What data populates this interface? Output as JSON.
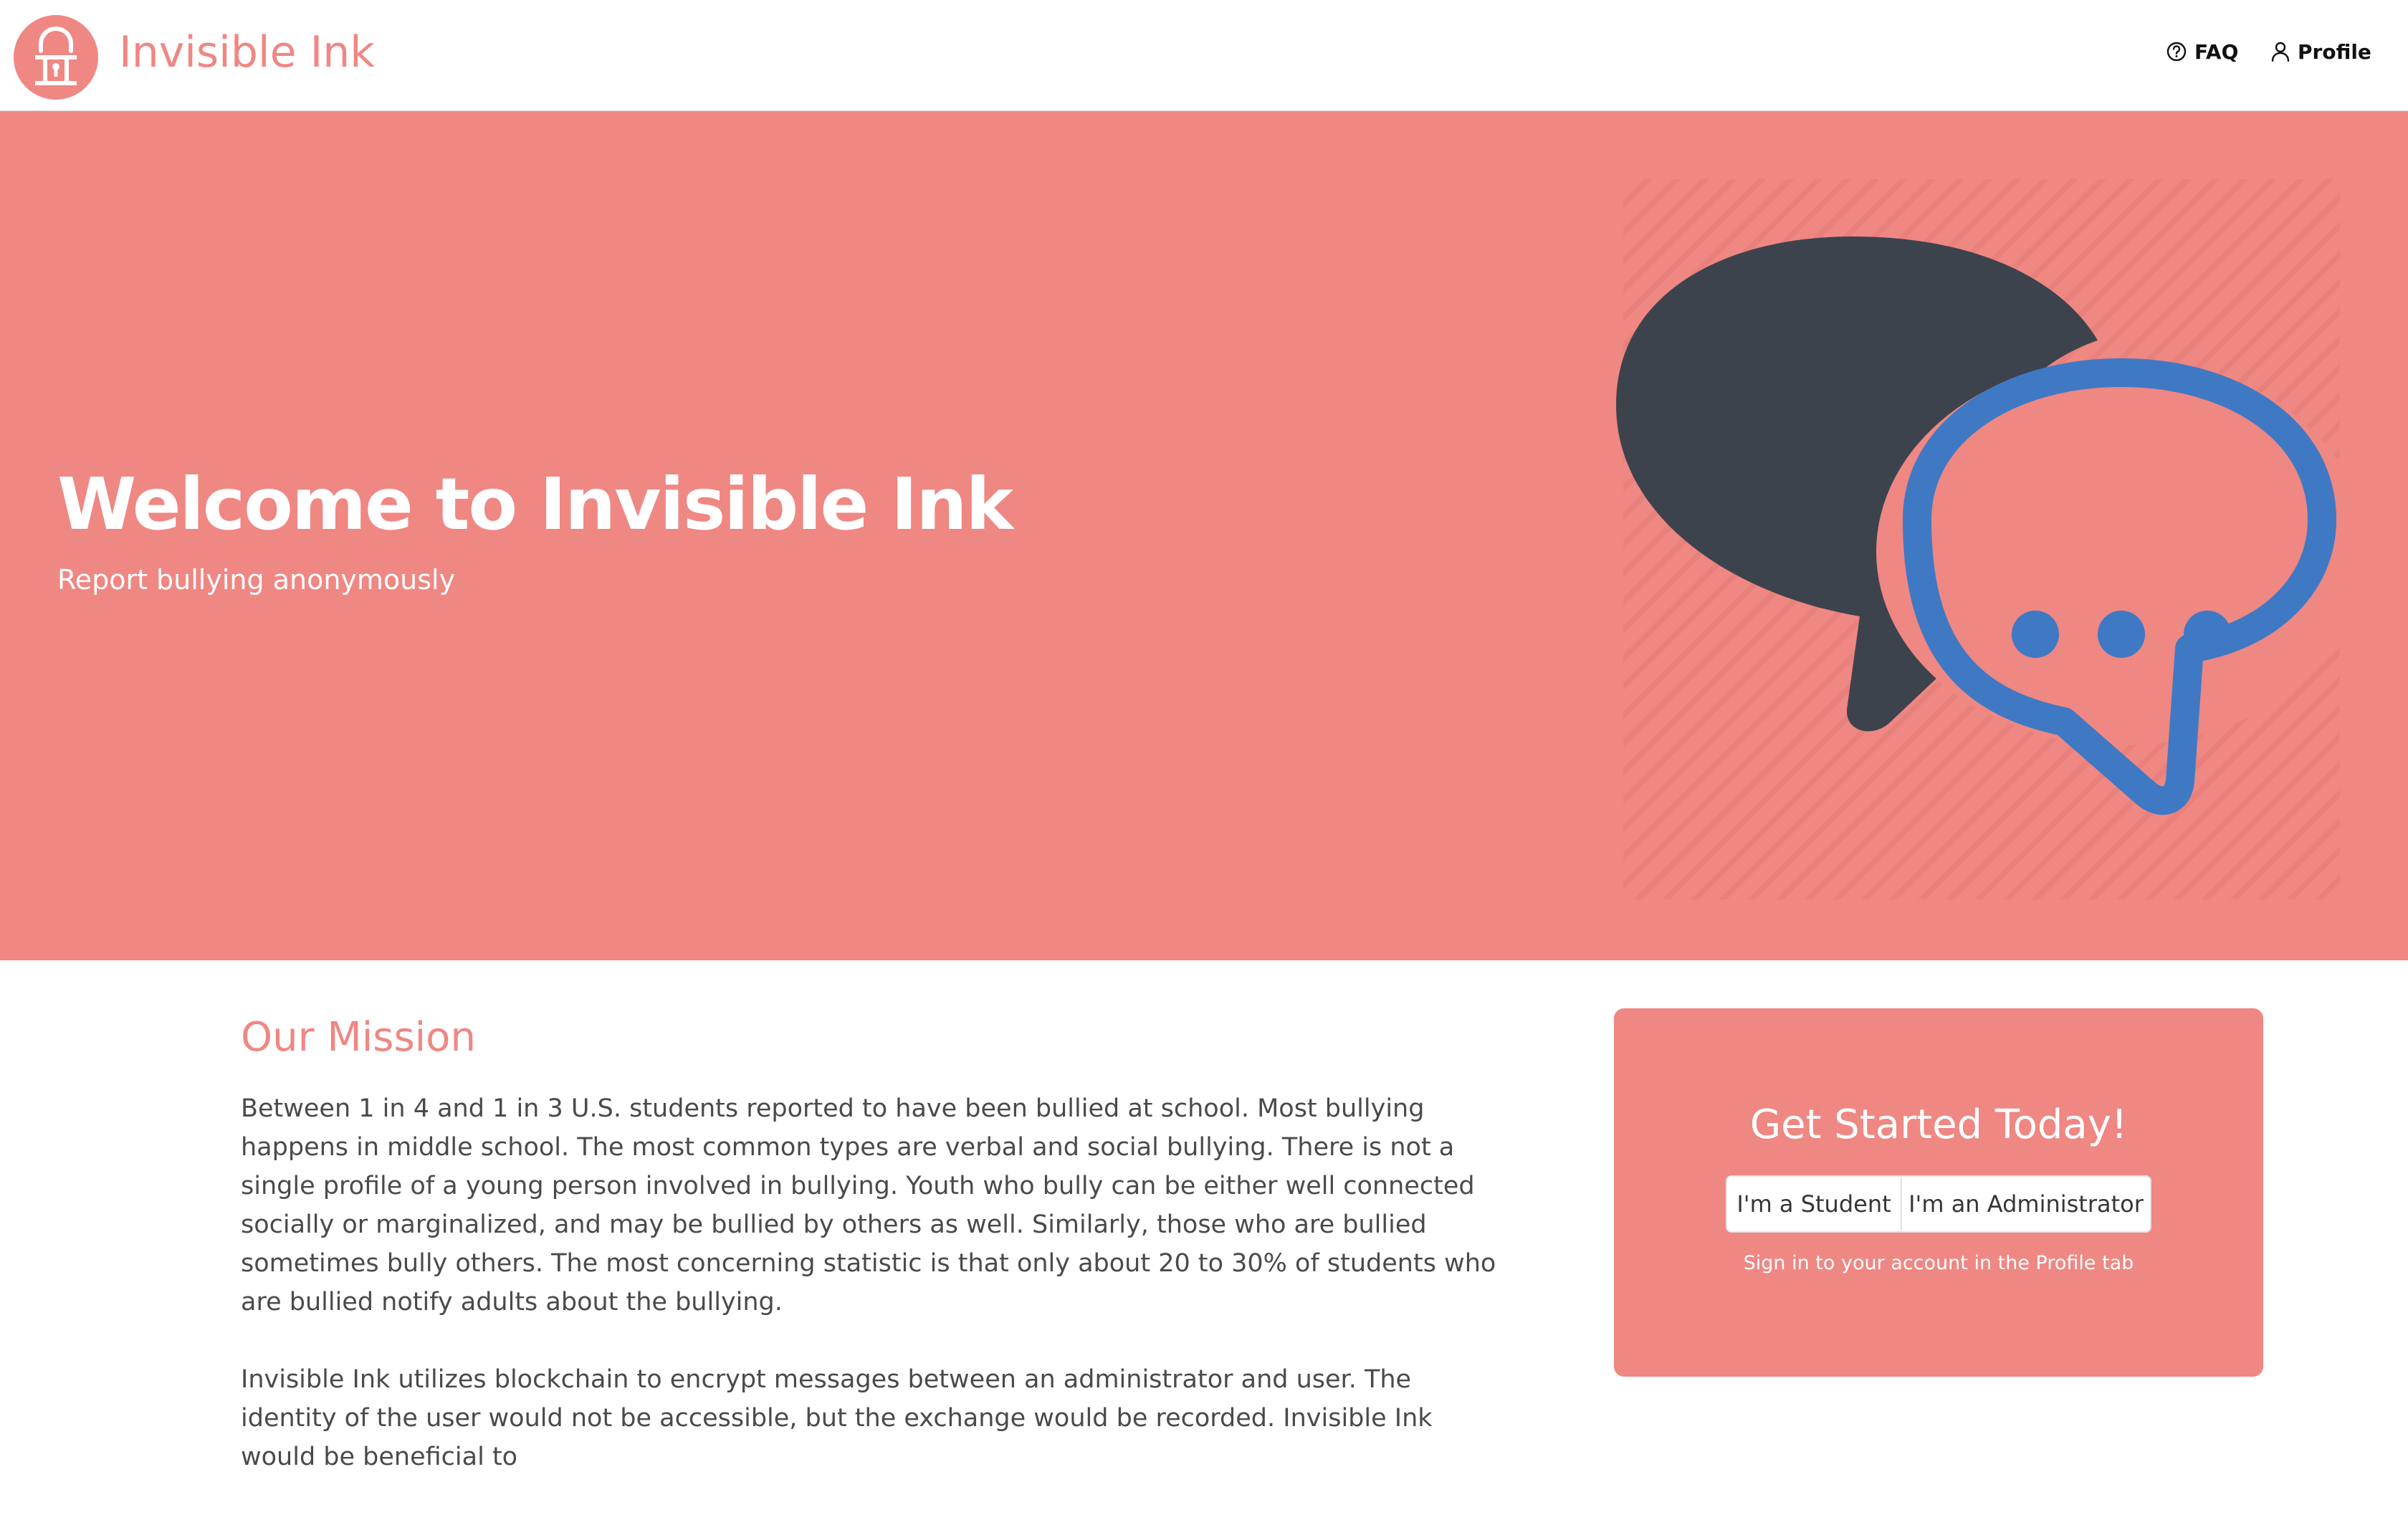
{
  "header": {
    "brand": "Invisible Ink",
    "nav": {
      "faq": "FAQ",
      "profile": "Profile"
    }
  },
  "hero": {
    "title": "Welcome to Invisible Ink",
    "subtitle": "Report bullying anonymously"
  },
  "mission": {
    "title": "Our Mission",
    "paragraphs": [
      "Between 1 in 4 and 1 in 3 U.S. students reported to have been bullied at school. Most bullying happens in middle school. The most common types are verbal and social bullying. There is not a single profile of a young person involved in bullying. Youth who bully can be either well connected socially or marginalized, and may be bullied by others as well. Similarly, those who are bullied sometimes bully others. The most concerning statistic is that only about 20 to 30% of students who are bullied notify adults about the bullying.",
      "Invisible Ink utilizes blockchain to encrypt messages between an administrator and user. The identity of the user would not be accessible, but the exchange would be recorded. Invisible Ink would be beneficial to"
    ]
  },
  "cta": {
    "title": "Get Started Today!",
    "student_button": "I'm a Student",
    "admin_button": "I'm an Administrator",
    "hint": "Sign in to your account in the Profile tab"
  },
  "colors": {
    "brand": "#ef8783",
    "dark_bubble": "#3d434d",
    "blue_bubble": "#3f79c4"
  },
  "icons": {
    "logo": "padlock-logo-icon",
    "faq": "question-circle-icon",
    "profile": "user-icon",
    "hero": "chat-bubbles-icon"
  }
}
